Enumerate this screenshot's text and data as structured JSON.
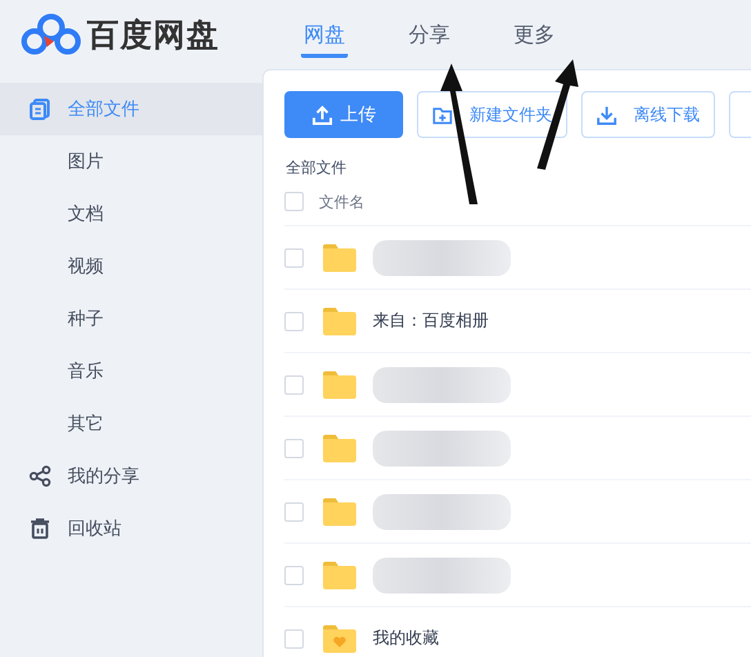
{
  "app": {
    "name": "百度网盘"
  },
  "tabs": [
    {
      "label": "网盘",
      "selected": true
    },
    {
      "label": "分享",
      "selected": false
    },
    {
      "label": "更多",
      "selected": false
    }
  ],
  "sidebar": {
    "items": [
      {
        "label": "全部文件",
        "selected": true
      },
      {
        "label": "图片",
        "selected": false
      },
      {
        "label": "文档",
        "selected": false
      },
      {
        "label": "视频",
        "selected": false
      },
      {
        "label": "种子",
        "selected": false
      },
      {
        "label": "音乐",
        "selected": false
      },
      {
        "label": "其它",
        "selected": false
      },
      {
        "label": "我的分享",
        "selected": false
      },
      {
        "label": "回收站",
        "selected": false
      }
    ]
  },
  "toolbar": [
    {
      "label": "上传",
      "kind": "primary"
    },
    {
      "label": "新建文件夹",
      "kind": "outline"
    },
    {
      "label": "离线下载",
      "kind": "outline"
    },
    {
      "kind": "cut"
    }
  ],
  "breadcrumb": "全部文件",
  "table": {
    "header": "文件名",
    "header_checked": false,
    "rows": [
      {
        "blurred": true,
        "checked": false,
        "kind": "folder"
      },
      {
        "name": "来自：百度相册",
        "checked": false,
        "kind": "folder"
      },
      {
        "blurred": true,
        "checked": false,
        "kind": "folder"
      },
      {
        "blurred": true,
        "checked": false,
        "kind": "folder"
      },
      {
        "blurred": true,
        "checked": false,
        "kind": "folder"
      },
      {
        "blurred": true,
        "checked": false,
        "kind": "folder"
      },
      {
        "name": "我的收藏",
        "checked": false,
        "kind": "favorites"
      }
    ]
  }
}
